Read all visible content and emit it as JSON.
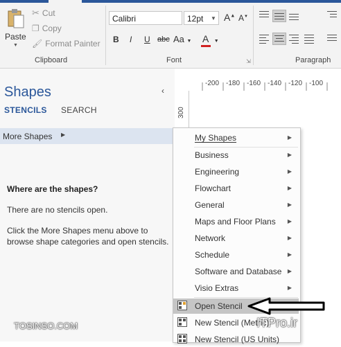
{
  "clipboard": {
    "paste": "Paste",
    "cut": "Cut",
    "copy": "Copy",
    "format_painter": "Format Painter",
    "group_label": "Clipboard"
  },
  "font": {
    "family": "Calibri",
    "size": "12pt",
    "grow": "A",
    "shrink": "A",
    "bold": "B",
    "italic": "I",
    "underline": "U",
    "strike": "abc",
    "case": "Aa",
    "color_letter": "A",
    "group_label": "Font",
    "color_bar": "#d02020"
  },
  "paragraph": {
    "group_label": "Paragraph"
  },
  "ruler": {
    "top_ticks": [
      "-200",
      "-180",
      "-160",
      "-140",
      "-120",
      "-100"
    ],
    "left_tick": "300"
  },
  "panel": {
    "title": "Shapes",
    "tab_stencils": "STENCILS",
    "tab_search": "SEARCH",
    "more_shapes": "More Shapes",
    "help_heading": "Where are the shapes?",
    "help_line1": "There are no stencils open.",
    "help_line2": "Click the More Shapes menu above to",
    "help_line3": "browse shape categories and open stencils."
  },
  "menu": {
    "my_shapes": "My Shapes",
    "items": [
      "Business",
      "Engineering",
      "Flowchart",
      "General",
      "Maps and Floor Plans",
      "Network",
      "Schedule",
      "Software and Database",
      "Visio Extras"
    ],
    "open_stencil": "Open Stencil",
    "new_stencil_metric": "New Stencil (Metric)",
    "new_stencil_us": "New Stencil (US Units)"
  },
  "watermark": {
    "left": "TOSINSO.COM",
    "right": "ITPro.ir"
  },
  "colors": {
    "accent": "#2b579a",
    "highlight": "#c5c5c5"
  }
}
